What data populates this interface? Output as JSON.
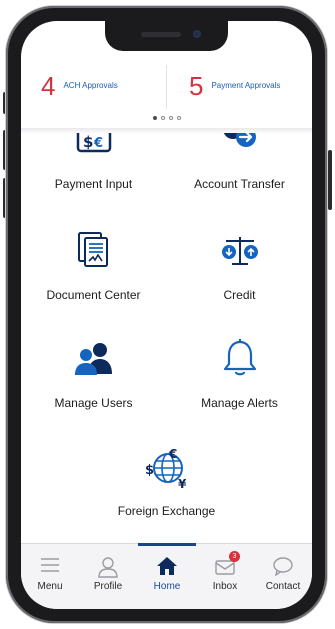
{
  "approvals": {
    "ach": {
      "count": "4",
      "label": "ACH Approvals"
    },
    "payment": {
      "count": "5",
      "label": "Payment Approvals"
    },
    "carousel_pages": 4,
    "carousel_active": 1
  },
  "tiles": {
    "payment_input": "Payment Input",
    "account_transfer": "Account Transfer",
    "document_center": "Document Center",
    "credit": "Credit",
    "manage_users": "Manage Users",
    "manage_alerts": "Manage Alerts",
    "foreign_exchange": "Foreign Exchange"
  },
  "tabbar": {
    "menu": "Menu",
    "profile": "Profile",
    "home": "Home",
    "inbox": "Inbox",
    "inbox_badge": "3",
    "contact": "Contact"
  },
  "colors": {
    "brand_blue": "#1a5eb5",
    "icon_blue": "#1565c0",
    "navy": "#0d2a5c",
    "alert_red": "#d33340"
  },
  "icons": {
    "payment_input": "check-payment-icon",
    "account_transfer": "transfer-arrow-icon",
    "document_center": "documents-icon",
    "credit": "scale-balance-icon",
    "manage_users": "users-icon",
    "manage_alerts": "bell-icon",
    "foreign_exchange": "globe-currency-icon"
  }
}
